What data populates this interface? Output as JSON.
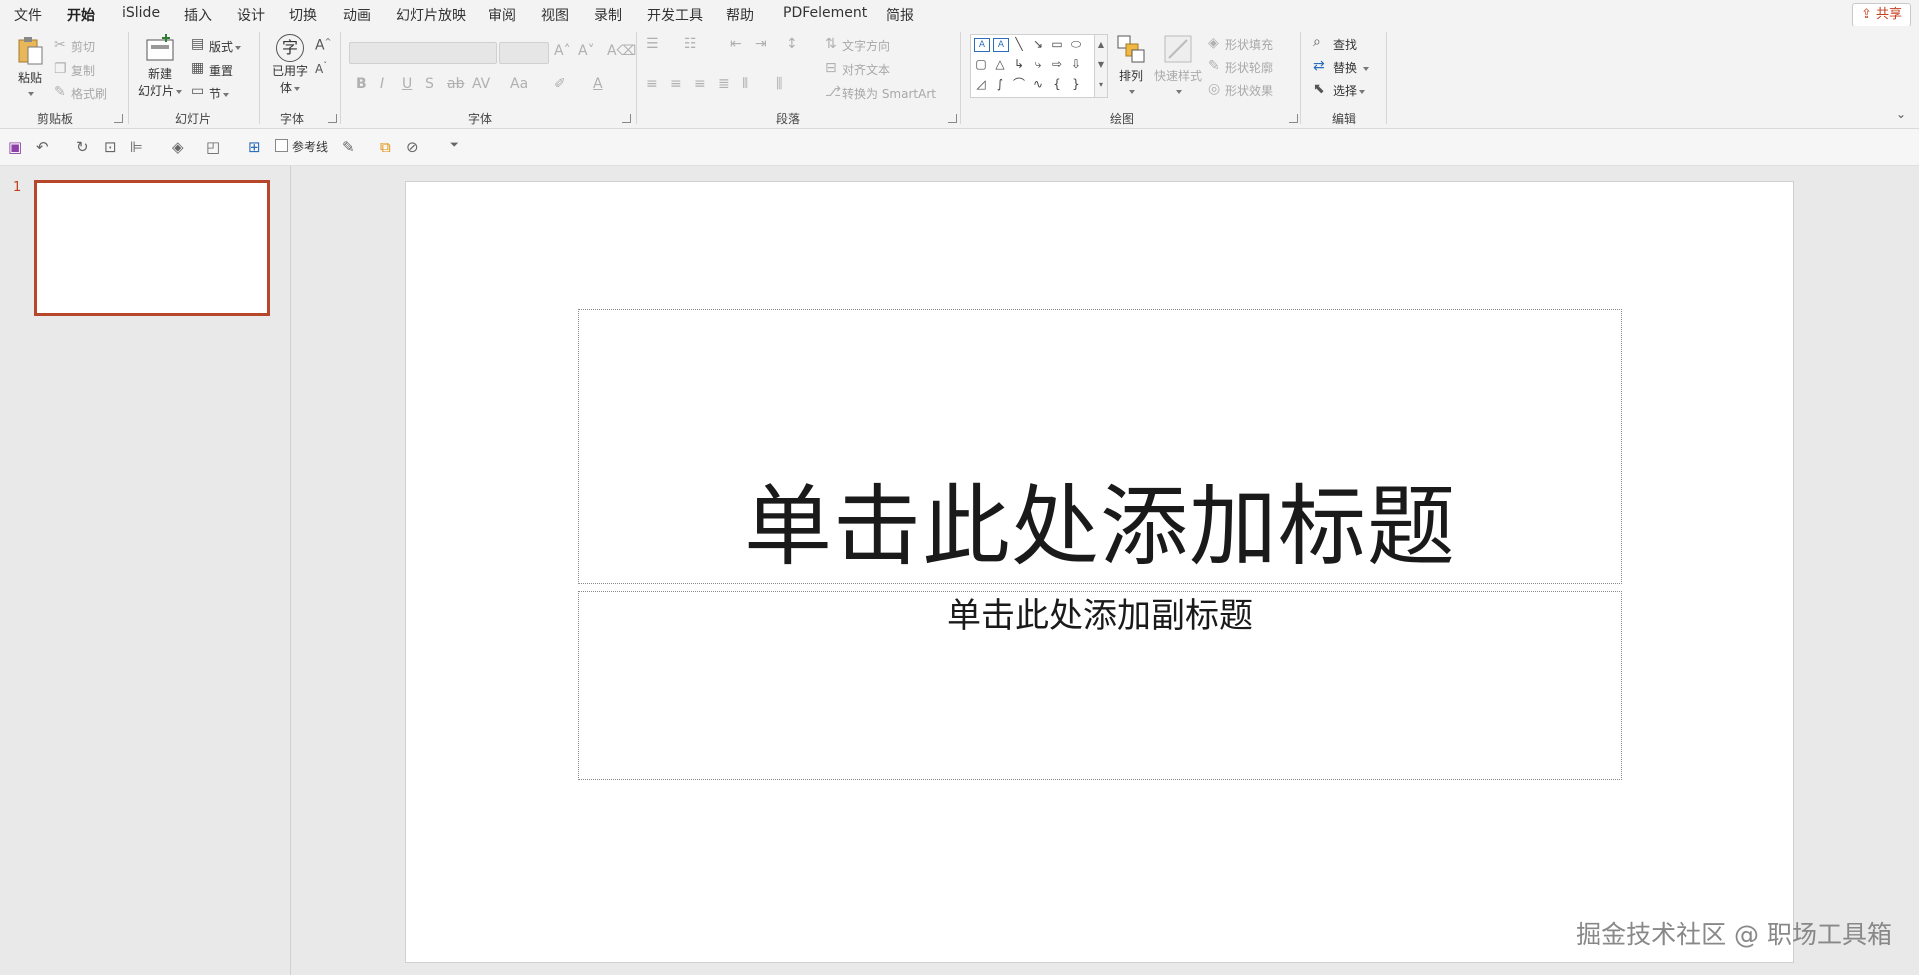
{
  "menu": {
    "tabs": [
      "文件",
      "开始",
      "iSlide",
      "插入",
      "设计",
      "切换",
      "动画",
      "幻灯片放映",
      "审阅",
      "视图",
      "录制",
      "开发工具",
      "帮助",
      "PDFelement",
      "简报"
    ],
    "active": "开始",
    "share": "共享"
  },
  "ribbon": {
    "clipboard": {
      "paste": "粘贴",
      "cut": "剪切",
      "copy": "复制",
      "format_painter": "格式刷",
      "group": "剪贴板"
    },
    "slides": {
      "new_slide_line1": "新建",
      "new_slide_line2": "幻灯片",
      "layout": "版式",
      "reset": "重置",
      "section": "节",
      "group": "幻灯片"
    },
    "fonts": {
      "used_fonts_line1": "已用字",
      "used_fonts_line2": "体",
      "icon_char": "字",
      "group": "字体"
    },
    "font": {
      "font_name_value": "",
      "font_size_value": "",
      "group": "字体"
    },
    "paragraph": {
      "text_direction": "文字方向",
      "align_text": "对齐文本",
      "convert_smartart": "转换为 SmartArt",
      "group": "段落"
    },
    "drawing": {
      "arrange": "排列",
      "quick_styles": "快速样式",
      "shape_fill": "形状填充",
      "shape_outline": "形状轮廓",
      "shape_effects": "形状效果",
      "group": "绘图"
    },
    "editing": {
      "find": "查找",
      "replace": "替换",
      "select": "选择",
      "group": "编辑"
    }
  },
  "qat": {
    "gridlines": "参考线"
  },
  "thumbnails": {
    "slide_number": "1"
  },
  "slide": {
    "title": "单击此处添加标题",
    "subtitle": "单击此处添加副标题"
  },
  "watermark": "掘金技术社区 @ 职场工具箱",
  "colors": {
    "accent": "#c43e1c",
    "thumb_border": "#b7472a"
  }
}
